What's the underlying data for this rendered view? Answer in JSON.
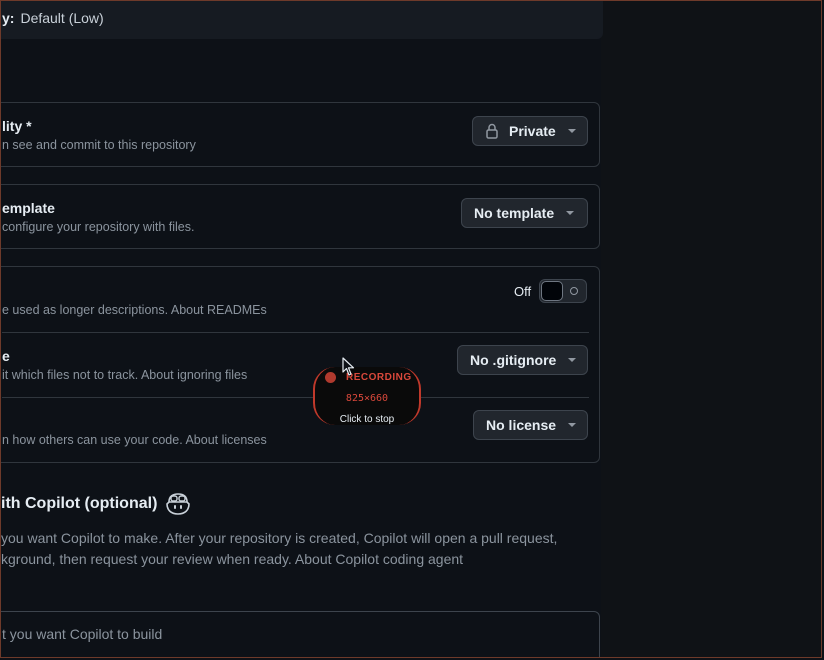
{
  "policy": {
    "key": "y:",
    "value": "Default (Low)"
  },
  "visibility": {
    "title": "lity *",
    "description": "n see and commit to this repository",
    "button_label": "Private"
  },
  "template": {
    "title": "emplate",
    "description": "configure your repository with files.",
    "button_label": "No template"
  },
  "readme": {
    "description": "e used as longer descriptions. About READMEs",
    "toggle_label": "Off"
  },
  "gitignore": {
    "title": "e",
    "description": "it which files not to track. About ignoring files",
    "button_label": "No .gitignore"
  },
  "license": {
    "description": "n how others can use your code. About licenses",
    "button_label": "No license"
  },
  "copilot": {
    "heading": "ith Copilot (optional)",
    "description_line1": "you want Copilot to make. After your repository is created, Copilot will open a pull request,",
    "description_line2": "kground, then request your review when ready. About Copilot coding agent",
    "prompt_placeholder": "t you want Copilot to build"
  },
  "recording": {
    "title": "RECORDING",
    "size": "825×660",
    "action": "Click to stop"
  },
  "colors": {
    "background": "#0d1117",
    "border": "#30363d",
    "button_bg": "#21262d",
    "recording_red": "#d9483b"
  },
  "icons": {
    "lock": "lock-icon",
    "caret": "triangle-down-icon",
    "copilot": "copilot-icon",
    "cursor": "mouse-pointer-icon"
  }
}
